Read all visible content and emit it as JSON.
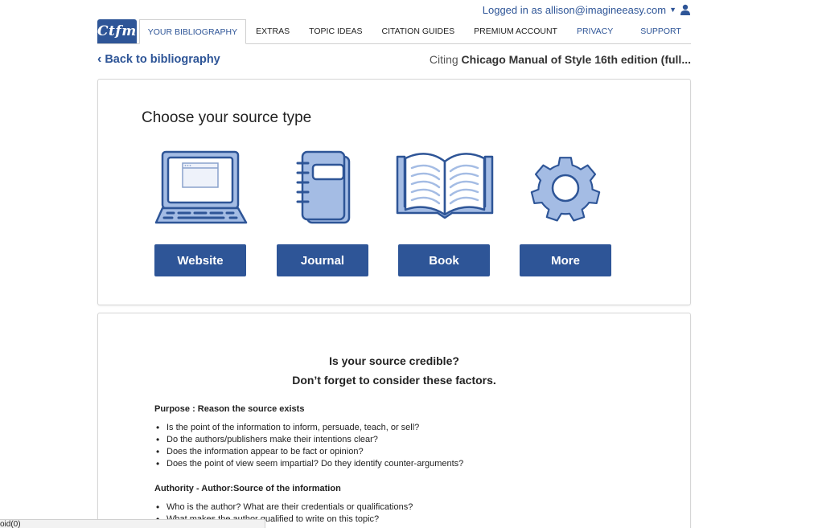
{
  "header": {
    "login_text": "Logged in as allison@imagineeasy.com"
  },
  "nav": {
    "logo": "Ctfm",
    "tabs": [
      {
        "label": "YOUR BIBLIOGRAPHY"
      },
      {
        "label": "EXTRAS"
      },
      {
        "label": "TOPIC IDEAS"
      },
      {
        "label": "CITATION GUIDES"
      },
      {
        "label": "PREMIUM ACCOUNT"
      }
    ],
    "right_links": [
      {
        "label": "PRIVACY"
      },
      {
        "label": "SUPPORT"
      }
    ]
  },
  "subheader": {
    "back_label": "Back to bibliography",
    "citing_prefix": "Citing",
    "citing_style": "Chicago Manual of Style 16th edition (full..."
  },
  "source_panel": {
    "title": "Choose your source type",
    "sources": [
      {
        "label": "Website",
        "icon": "laptop-icon"
      },
      {
        "label": "Journal",
        "icon": "notebook-icon"
      },
      {
        "label": "Book",
        "icon": "open-book-icon"
      },
      {
        "label": "More",
        "icon": "gear-icon"
      }
    ]
  },
  "credibility": {
    "question1": "Is your source credible?",
    "question2": "Don’t forget to consider these factors.",
    "sections": [
      {
        "title": "Purpose : Reason the source exists",
        "items": [
          "Is the point of the information to inform, persuade, teach, or sell?",
          "Do the authors/publishers make their intentions clear?",
          "Does the information appear to be fact or opinion?",
          "Does the point of view seem impartial? Do they identify counter-arguments?"
        ]
      },
      {
        "title": "Authority - Author:Source of the information",
        "items": [
          "Who is the author? What are their credentials or qualifications?",
          "What makes the author qualified to write on this topic?"
        ]
      }
    ]
  },
  "statusbar": {
    "text": "oid(0)"
  },
  "colors": {
    "brand": "#2e5597",
    "icon_fill": "#a4bce4",
    "icon_stroke": "#2e5597"
  }
}
